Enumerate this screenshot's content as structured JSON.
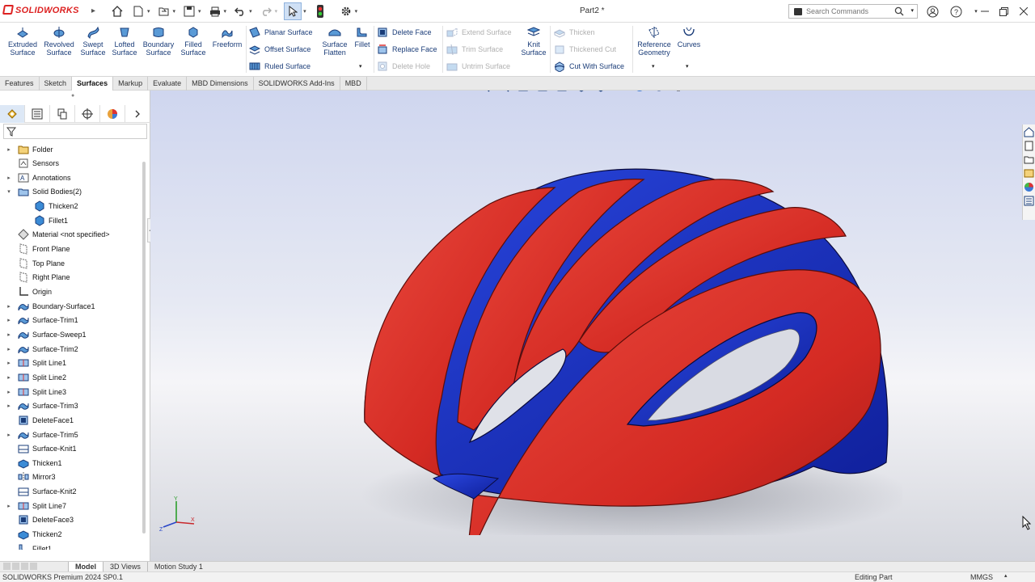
{
  "app": {
    "brand": "SOLIDWORKS",
    "document_title": "Part2 *"
  },
  "search": {
    "placeholder": "Search Commands"
  },
  "ribbon": {
    "large_buttons": [
      {
        "label1": "Extruded",
        "label2": "Surface"
      },
      {
        "label1": "Revolved",
        "label2": "Surface"
      },
      {
        "label1": "Swept",
        "label2": "Surface"
      },
      {
        "label1": "Lofted",
        "label2": "Surface"
      },
      {
        "label1": "Boundary",
        "label2": "Surface"
      },
      {
        "label1": "Filled",
        "label2": "Surface"
      },
      {
        "label1": "Freeform",
        "label2": ""
      }
    ],
    "surface_column": [
      "Planar Surface",
      "Offset Surface",
      "Ruled Surface"
    ],
    "flatten": {
      "label1": "Surface",
      "label2": "Flatten"
    },
    "fillet": {
      "label1": "Fillet"
    },
    "face_column": [
      "Delete Face",
      "Replace Face",
      "Delete Hole"
    ],
    "extend_column": [
      "Extend Surface",
      "Trim Surface",
      "Untrim Surface"
    ],
    "knit": {
      "label1": "Knit",
      "label2": "Surface"
    },
    "thicken_column": [
      "Thicken",
      "Thickened Cut",
      "Cut With Surface"
    ],
    "reference": {
      "label1": "Reference",
      "label2": "Geometry"
    },
    "curves": {
      "label1": "Curves"
    }
  },
  "tabs": [
    "Features",
    "Sketch",
    "Surfaces",
    "Markup",
    "Evaluate",
    "MBD Dimensions",
    "SOLIDWORKS Add-Ins",
    "MBD"
  ],
  "active_tab": "Surfaces",
  "tree": [
    {
      "label": "Folder",
      "expand": true
    },
    {
      "label": "Sensors",
      "expand": false
    },
    {
      "label": "Annotations",
      "expand": true
    },
    {
      "label": "Solid Bodies(2)",
      "expand": true,
      "open": true
    },
    {
      "label": "Thicken2",
      "child": true
    },
    {
      "label": "Fillet1",
      "child": true
    },
    {
      "label": "Material <not specified>",
      "expand": false
    },
    {
      "label": "Front Plane",
      "expand": false
    },
    {
      "label": "Top Plane",
      "expand": false
    },
    {
      "label": "Right Plane",
      "expand": false
    },
    {
      "label": "Origin",
      "expand": false
    },
    {
      "label": "Boundary-Surface1",
      "expand": true
    },
    {
      "label": "Surface-Trim1",
      "expand": true
    },
    {
      "label": "Surface-Sweep1",
      "expand": true
    },
    {
      "label": "Surface-Trim2",
      "expand": true
    },
    {
      "label": "Split Line1",
      "expand": true
    },
    {
      "label": "Split Line2",
      "expand": true
    },
    {
      "label": "Split Line3",
      "expand": true
    },
    {
      "label": "Surface-Trim3",
      "expand": true
    },
    {
      "label": "DeleteFace1",
      "expand": false
    },
    {
      "label": "Surface-Trim5",
      "expand": true
    },
    {
      "label": "Surface-Knit1",
      "expand": false
    },
    {
      "label": "Thicken1",
      "expand": false
    },
    {
      "label": "Mirror3",
      "expand": false
    },
    {
      "label": "Surface-Knit2",
      "expand": false
    },
    {
      "label": "Split Line7",
      "expand": true
    },
    {
      "label": "DeleteFace3",
      "expand": false
    },
    {
      "label": "Thicken2",
      "expand": false
    },
    {
      "label": "Fillet1",
      "expand": false
    }
  ],
  "bottom_tabs": [
    "Model",
    "3D Views",
    "Motion Study 1"
  ],
  "status": {
    "left": "SOLIDWORKS Premium 2024 SP0.1",
    "mode": "Editing Part",
    "units": "MMGS"
  },
  "colors": {
    "red": "#d42a23",
    "blue": "#1b36c8",
    "accent": "#1a3c78"
  }
}
